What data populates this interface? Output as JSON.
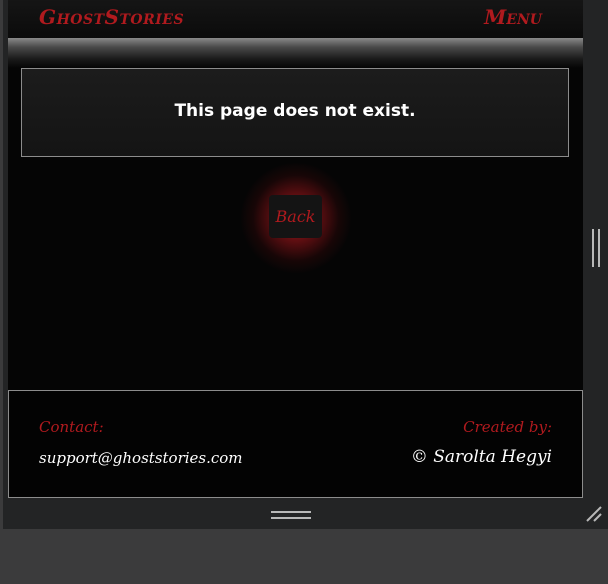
{
  "header": {
    "brand": "GhostStories",
    "menu_label": "Menu"
  },
  "main": {
    "message": "This page does not exist.",
    "back_label": "Back"
  },
  "footer": {
    "contact_label": "Contact:",
    "contact_email": "support@ghoststories.com",
    "created_label": "Created by:",
    "author": "© Sarolta Hegyi"
  },
  "colors": {
    "accent": "#b01a1e",
    "background": "#050505",
    "frame": "#232425"
  },
  "icons": {
    "vertical_resize": "drag-handle-vertical-icon",
    "horizontal_resize": "drag-handle-horizontal-icon",
    "corner_resize": "resize-corner-icon"
  }
}
